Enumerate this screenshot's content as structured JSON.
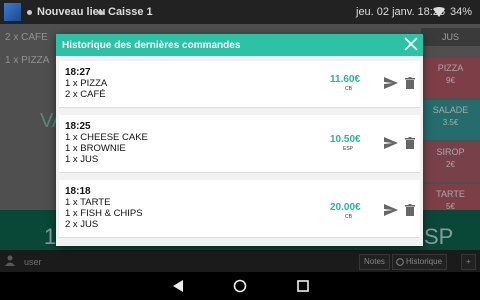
{
  "status_bar": {
    "location": "Nouveau lieu",
    "register": "Caisse 1",
    "datetime": "jeu. 02 janv. 18:26",
    "battery": "34%"
  },
  "background": {
    "order_lines": [
      "2 x CAFE",
      "1 x PIZZA"
    ],
    "jus_tab": "JUS",
    "products": [
      {
        "name": "PIZZA",
        "price": "9€",
        "color": "#c0606e"
      },
      {
        "name": "SALADE",
        "price": "3.5€",
        "color": "#3aa7a7"
      },
      {
        "name": "SIROP",
        "price": "2€",
        "color": "#b96470"
      },
      {
        "name": "TARTE",
        "price": "5€",
        "color": "#c0606e"
      }
    ],
    "user_label": "user",
    "notes_label": "Notes",
    "history_label": "Historique",
    "plus_label": "+"
  },
  "dialog": {
    "title": "Historique des dernières commandes",
    "orders": [
      {
        "time": "18:27",
        "items": [
          "1 x PIZZA",
          "2 x CAFÉ"
        ],
        "amount": "11.60€",
        "method": "CB"
      },
      {
        "time": "18:25",
        "items": [
          "1 x CHEESE CAKE",
          "1 x BROWNIE",
          "1 x JUS"
        ],
        "amount": "10.50€",
        "method": "ESP"
      },
      {
        "time": "18:18",
        "items": [
          "1 x TARTE",
          "1 x FISH & CHIPS",
          "2 x JUS"
        ],
        "amount": "20.00€",
        "method": "CB"
      }
    ]
  },
  "nav": {
    "back_icon": "back-triangle-icon",
    "home_icon": "home-circle-icon",
    "recents_icon": "recents-square-icon"
  },
  "colors": {
    "accent": "#2bc3a4",
    "amount": "#26b596"
  }
}
